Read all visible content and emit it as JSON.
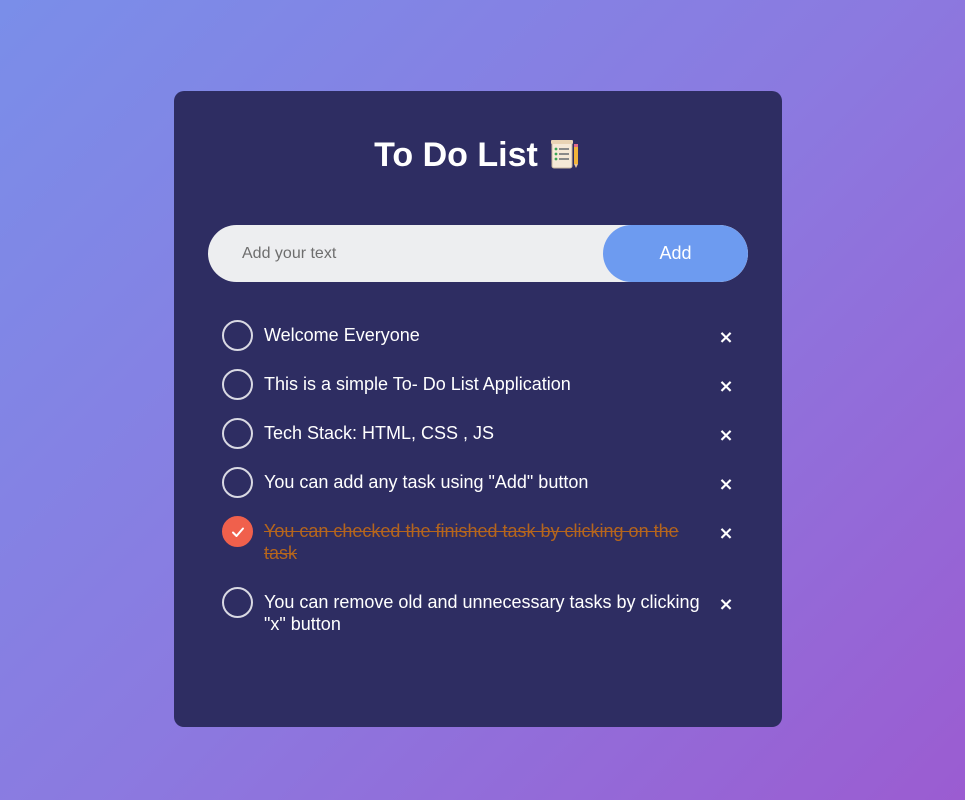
{
  "app": {
    "title": "To Do List",
    "title_icon": "notepad-icon"
  },
  "input": {
    "placeholder": "Add your text",
    "value": "",
    "add_label": "Add"
  },
  "colors": {
    "card": "#2e2d62",
    "accent": "#6d9bf0",
    "checked": "#f0604c",
    "done_text": "#b5651d"
  },
  "tasks": [
    {
      "text": "Welcome Everyone",
      "done": false,
      "delete_label": "×"
    },
    {
      "text": "This is a simple To- Do List Application",
      "done": false,
      "delete_label": "×"
    },
    {
      "text": "Tech Stack: HTML, CSS , JS",
      "done": false,
      "delete_label": "×"
    },
    {
      "text": "You can add any task using \"Add\" button",
      "done": false,
      "delete_label": "×"
    },
    {
      "text": "You can checked the finished task by clicking on the task",
      "done": true,
      "delete_label": "×"
    },
    {
      "text": "You can remove old and unnecessary tasks by clicking \"x\" button",
      "done": false,
      "delete_label": "×"
    }
  ]
}
